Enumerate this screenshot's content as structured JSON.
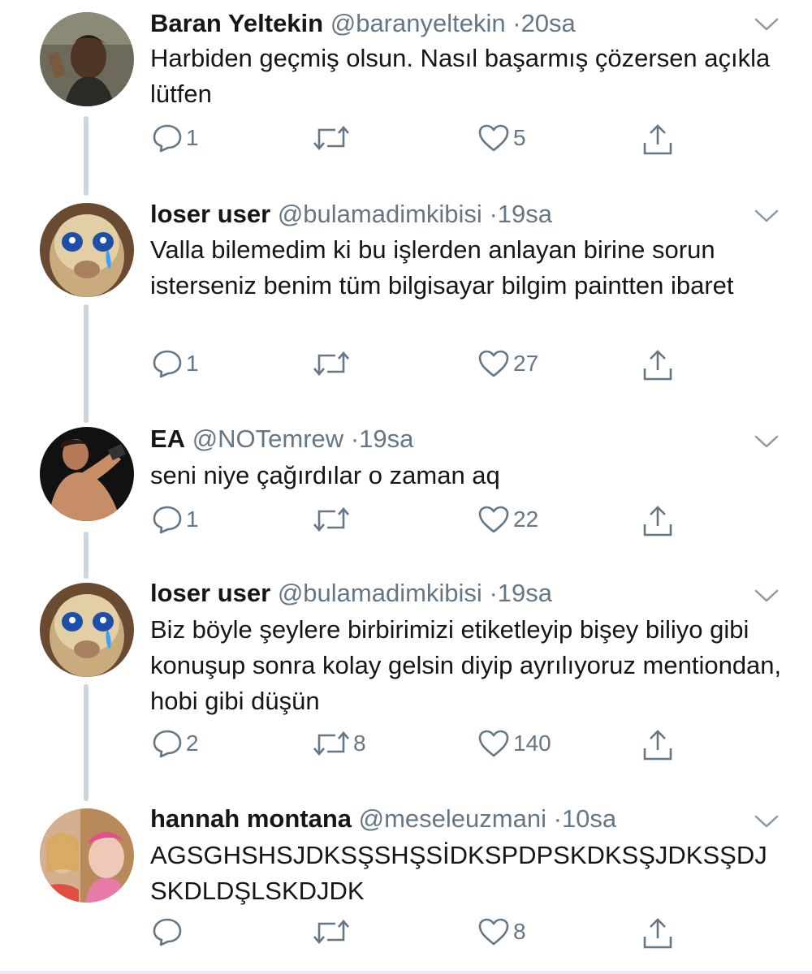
{
  "tweets": [
    {
      "name": "Baran Yeltekin",
      "handle": "@baranyeltekin",
      "time": "20sa",
      "text": "Harbiden geçmiş olsun. Nasıl başarmış çözersen açıkla lütfen",
      "replies": "1",
      "retweets": "",
      "likes": "5",
      "avatar_colors": [
        "#3a3f3a",
        "#6b4b34",
        "#8a7a5a"
      ]
    },
    {
      "name": "loser user",
      "handle": "@bulamadimkibisi",
      "time": "19sa",
      "text": "Valla bilemedim ki bu işlerden anlayan birine sorun isterseniz benim tüm bilgisayar bilgim paintten ibaret",
      "replies": "1",
      "retweets": "",
      "likes": "27",
      "avatar_colors": [
        "#b08a5e",
        "#d9c29a",
        "#5aa0e0"
      ]
    },
    {
      "name": "EA",
      "handle": "@NOTemrew",
      "time": "19sa",
      "text": "seni niye çağırdılar o zaman aq",
      "replies": "1",
      "retweets": "",
      "likes": "22",
      "avatar_colors": [
        "#1a1a1a",
        "#c98f6a",
        "#3a2a20"
      ]
    },
    {
      "name": "loser user",
      "handle": "@bulamadimkibisi",
      "time": "19sa",
      "text": "Biz böyle şeylere birbirimizi etiketleyip bişey biliyo gibi konuşup sonra kolay gelsin diyip ayrılıyoruz mentiondan, hobi gibi düşün",
      "replies": "2",
      "retweets": "8",
      "likes": "140",
      "avatar_colors": [
        "#b08a5e",
        "#d9c29a",
        "#5aa0e0"
      ]
    },
    {
      "name": "hannah montana",
      "handle": "@meseleuzmani",
      "time": "10sa",
      "text": "AGSGHSHSJDKSŞSHŞSİDKSPDPSKDKSŞJDKSŞDJSKDLDŞLSKDJDK",
      "replies": "",
      "retweets": "",
      "likes": "8",
      "avatar_colors": [
        "#c87a5a",
        "#e8b0a0",
        "#f0d060"
      ]
    }
  ],
  "icons": {
    "reply": "reply-icon",
    "retweet": "retweet-icon",
    "like": "heart-icon",
    "share": "share-icon",
    "caret": "chevron-down-icon"
  },
  "colors": {
    "name": "#14171a",
    "meta": "#657786",
    "thread_line": "#ccd6dd"
  }
}
